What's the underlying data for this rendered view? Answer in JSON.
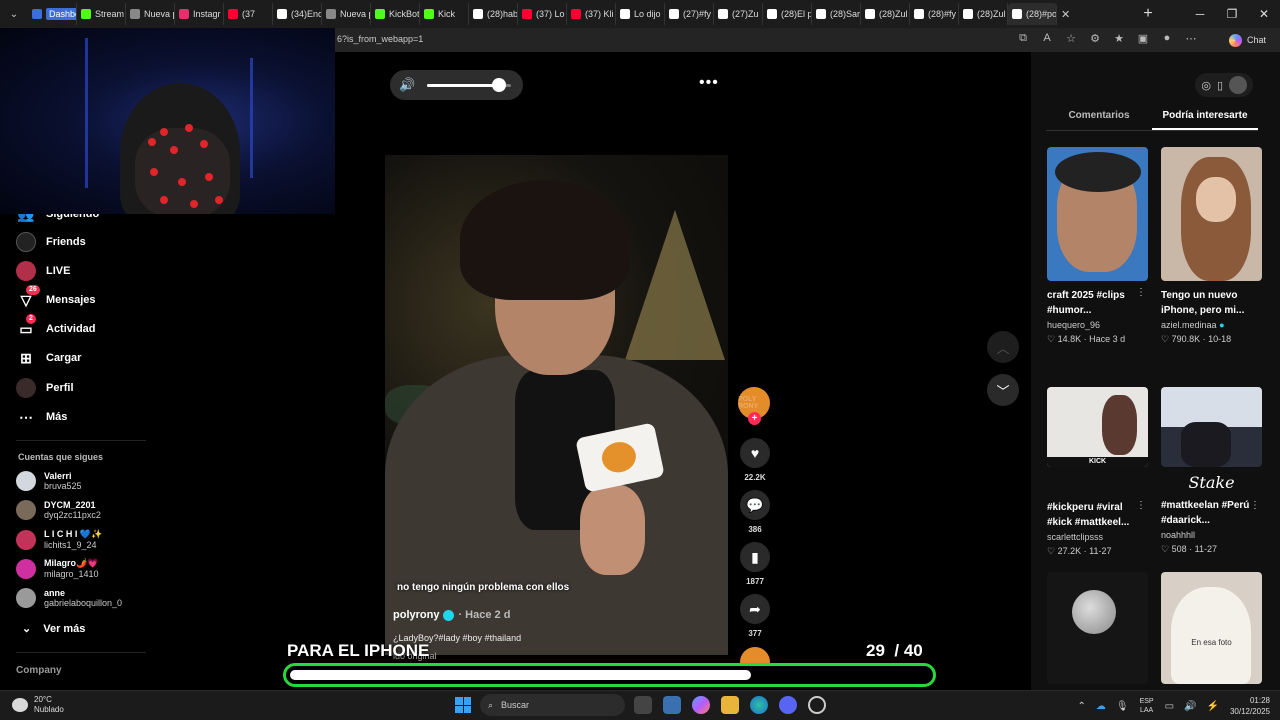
{
  "browser": {
    "tabs": [
      {
        "label": "Dashbo",
        "color": "#3b6fd8",
        "badge": true
      },
      {
        "label": "Stream",
        "color": "#53fc18"
      },
      {
        "label": "Nueva p",
        "color": "#888888"
      },
      {
        "label": "Instagr",
        "color": "#e1306c"
      },
      {
        "label": "(37",
        "color": "#ff0033"
      },
      {
        "label": "(34)Enc",
        "color": "#ffffff"
      },
      {
        "label": "Nueva p",
        "color": "#888888"
      },
      {
        "label": "KickBot",
        "color": "#53fc18"
      },
      {
        "label": "Kick",
        "color": "#53fc18"
      },
      {
        "label": "(28)hab",
        "color": "#ffffff"
      },
      {
        "label": "(37) Lo",
        "color": "#ff0033"
      },
      {
        "label": "(37) Kli",
        "color": "#ff0033"
      },
      {
        "label": "Lo dijo",
        "color": "#ffffff"
      },
      {
        "label": "(27)#fy",
        "color": "#ffffff"
      },
      {
        "label": "(27)Zu",
        "color": "#ffffff"
      },
      {
        "label": "(28)El p",
        "color": "#ffffff"
      },
      {
        "label": "(28)Sar",
        "color": "#ffffff"
      },
      {
        "label": "(28)Zul",
        "color": "#ffffff"
      },
      {
        "label": "(28)#fy",
        "color": "#ffffff"
      },
      {
        "label": "(28)Zul",
        "color": "#ffffff"
      },
      {
        "label": "(28)#po",
        "color": "#ffffff"
      }
    ],
    "url": "6?is_from_webapp=1",
    "chat_label": "Chat",
    "new_tab": "+",
    "close_tab": "✕"
  },
  "sidebar": {
    "items": [
      {
        "label": "Siguiendo",
        "icon": "following-icon"
      },
      {
        "label": "Friends",
        "icon": "friends-icon"
      },
      {
        "label": "LIVE",
        "icon": "live-icon"
      },
      {
        "label": "Mensajes",
        "icon": "messages-icon",
        "badge": "26"
      },
      {
        "label": "Actividad",
        "icon": "activity-icon",
        "badge": "2"
      },
      {
        "label": "Cargar",
        "icon": "upload-icon"
      },
      {
        "label": "Perfil",
        "icon": "profile-icon"
      },
      {
        "label": "Más",
        "icon": "more-icon"
      }
    ],
    "following_heading": "Cuentas que sigues",
    "following": [
      {
        "name": "Valerri",
        "handle": "bruva525",
        "color": "#d3d8de"
      },
      {
        "name": "DYCM_2201",
        "handle": "dyq2zc11pxc2",
        "color": "#7a6a5a"
      },
      {
        "name": "L I C H I 💙✨",
        "handle": "lichits1_9_24",
        "color": "#c2335a"
      },
      {
        "name": "Milagro🌶️💗",
        "handle": "milagro_1410",
        "color": "#d02fa0"
      },
      {
        "name": "anne",
        "handle": "gabrielaboquillon_0",
        "color": "#9a9a9a"
      }
    ],
    "see_more": "Ver más",
    "company": "Company"
  },
  "video": {
    "volume": 0.85,
    "subtitle": "no tengo ningún problema con ellos",
    "author": "polyrony",
    "time": "· Hace 2 d",
    "caption": "¿LadyBoy?#lady #boy #thailand",
    "sound": "ido original",
    "likes": "22.2K",
    "comments": "386",
    "saves": "1877",
    "shares": "377",
    "creator_label": "POLY RONY"
  },
  "overlay": {
    "title": "PARA EL IPHONE",
    "current": "29",
    "total": "/ 40",
    "progress": 0.725
  },
  "right_panel": {
    "tabs": [
      "Comentarios",
      "Podría interesarte"
    ],
    "active_tab": 1,
    "cards": [
      {
        "title": "craft 2025 #clips #humor...",
        "author": "huequero_96",
        "likes": "14.8K",
        "date": "Hace 3 d",
        "verified": false,
        "thumb": "#3a78c0"
      },
      {
        "title": "Tengo un nuevo iPhone, pero mi...",
        "author": "aziel.medinaa",
        "likes": "790.8K",
        "date": "10-18",
        "verified": true,
        "thumb": "#c9b7a8"
      },
      {
        "title": "#kickperu #viral #kick #mattkeel...",
        "author": "scarlettclipsss",
        "likes": "27.2K",
        "date": "11-27",
        "verified": false,
        "thumb": "#e8e6e2",
        "overlay_text": "KICK"
      },
      {
        "title": "#mattkeelan #Perú #daarick...",
        "author": "noahhhll",
        "likes": "508",
        "date": "11-27",
        "verified": false,
        "thumb": "#2a2e3a",
        "overlay_text": "Stake"
      },
      {
        "title": "",
        "author": "",
        "likes": "",
        "date": "",
        "verified": false,
        "thumb": "#151515"
      },
      {
        "title": "",
        "author": "",
        "likes": "",
        "date": "",
        "verified": false,
        "thumb": "#d8cfc6",
        "overlay_text": "En esa foto"
      }
    ]
  },
  "taskbar": {
    "temp": "20°C",
    "weather": "Nublado",
    "search_placeholder": "Buscar",
    "lang_top": "ESP",
    "lang_bottom": "LAA",
    "time": "01:28",
    "date": "30/12/2025"
  },
  "colors": {
    "accent_red": "#fe2c55",
    "progress_green": "#28d93a"
  }
}
